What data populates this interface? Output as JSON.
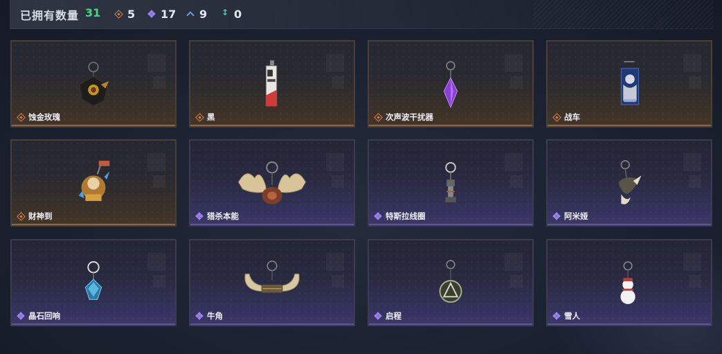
{
  "header": {
    "owned_label": "已拥有数量",
    "owned_count": "31",
    "stats": [
      {
        "rarity": "orange",
        "icon": "orange-diamond-icon",
        "value": "5"
      },
      {
        "rarity": "purple",
        "icon": "purple-clover-icon",
        "value": "17"
      },
      {
        "rarity": "blue",
        "icon": "blue-chevron-icon",
        "value": "9"
      },
      {
        "rarity": "green",
        "icon": "green-arrows-icon",
        "value": "0"
      }
    ]
  },
  "colors": {
    "accent_green": "#3fdc7b",
    "orange_rarity": "#d9834a",
    "purple_rarity": "#9a84f0",
    "blue_rarity": "#5aa0e6",
    "green_rarity": "#3fd2b4"
  },
  "items": [
    {
      "name": "蚀金玫瑰",
      "rarity": "orange",
      "icon": "gold-rose-charm-icon"
    },
    {
      "name": "黑",
      "rarity": "orange",
      "icon": "black-tag-charm-icon"
    },
    {
      "name": "次声波干扰器",
      "rarity": "orange",
      "icon": "purple-crystal-charm-icon"
    },
    {
      "name": "战车",
      "rarity": "orange",
      "icon": "chariot-card-charm-icon"
    },
    {
      "name": "财神到",
      "rarity": "orange",
      "icon": "fortune-god-charm-icon"
    },
    {
      "name": "猎杀本能",
      "rarity": "purple",
      "icon": "moose-antler-charm-icon"
    },
    {
      "name": "特斯拉线圈",
      "rarity": "purple",
      "icon": "tesla-coil-charm-icon"
    },
    {
      "name": "阿米娅",
      "rarity": "purple",
      "icon": "amiya-charm-icon"
    },
    {
      "name": "晶石回响",
      "rarity": "purple",
      "icon": "crystal-echo-charm-icon"
    },
    {
      "name": "牛角",
      "rarity": "purple",
      "icon": "bull-horn-charm-icon"
    },
    {
      "name": "启程",
      "rarity": "purple",
      "icon": "departure-medal-charm-icon"
    },
    {
      "name": "雪人",
      "rarity": "purple",
      "icon": "snowman-charm-icon"
    }
  ]
}
